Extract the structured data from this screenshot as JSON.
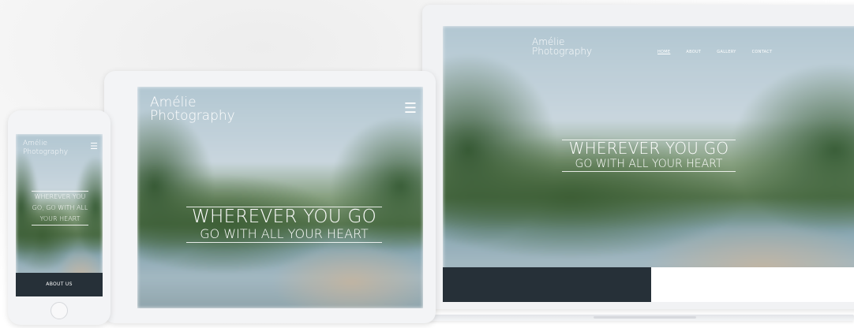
{
  "brand": {
    "line1": "Amélie",
    "line2": "Photography"
  },
  "hero": {
    "line1": "WHEREVER YOU GO",
    "line2": "GO WITH ALL YOUR HEART"
  },
  "phone": {
    "hero_lines": [
      "WHEREVER YOU",
      "GO, GO WITH ALL",
      "YOUR HEART"
    ],
    "about_button": "ABOUT US",
    "menu_icon": "hamburger-menu-icon"
  },
  "tablet": {
    "menu_icon": "hamburger-menu-icon"
  },
  "laptop": {
    "nav": [
      "HOME",
      "ABOUT",
      "GALLERY",
      "CONTACT"
    ],
    "active_nav": "HOME"
  },
  "colors": {
    "dark_panel": "#263038",
    "text": "#ffffff",
    "device_frame": "#f3f4f6"
  }
}
